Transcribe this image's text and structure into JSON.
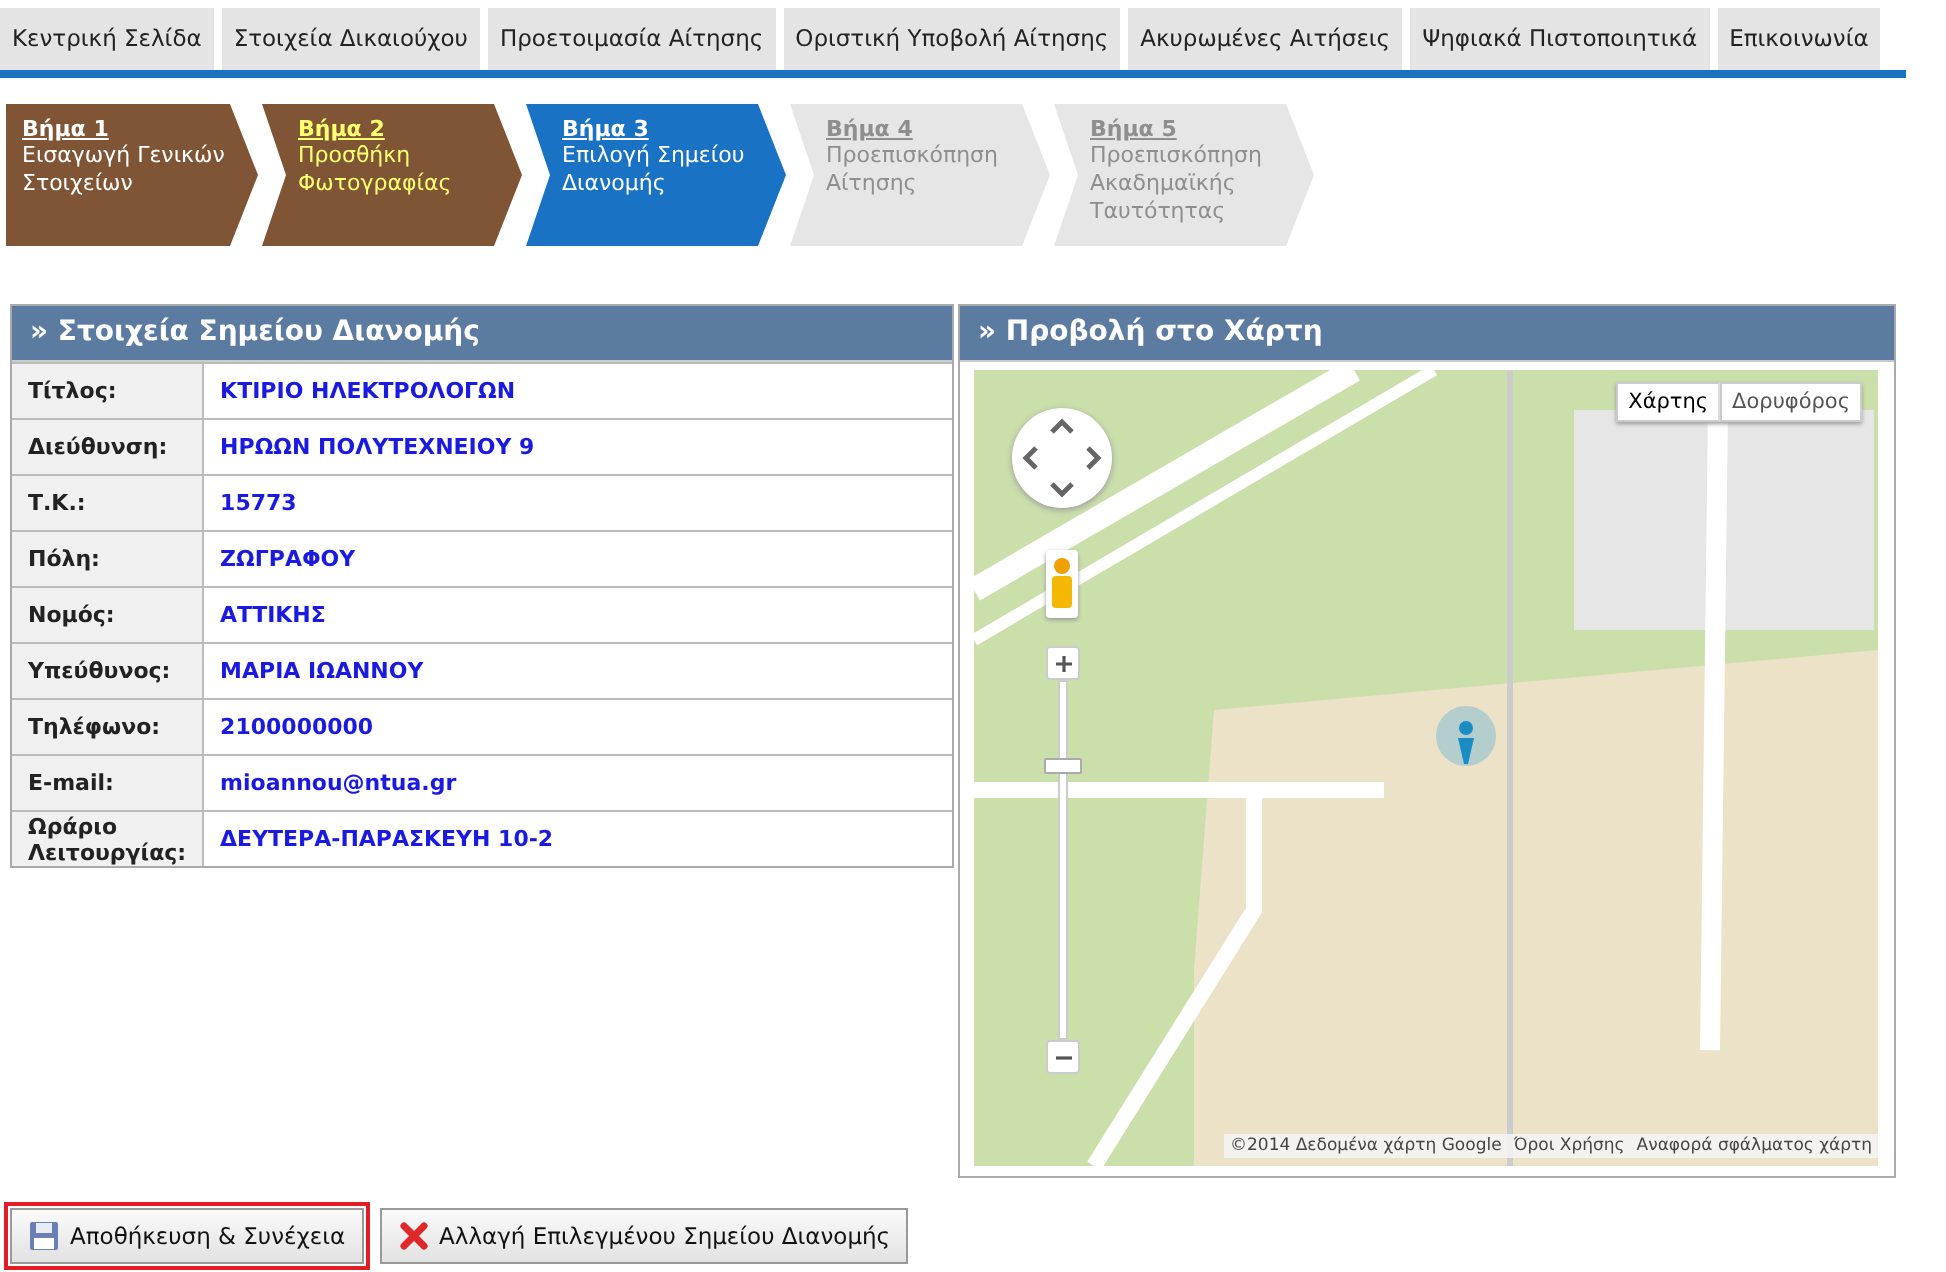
{
  "nav_tabs": [
    {
      "label": "Κεντρική Σελίδα",
      "selected": false
    },
    {
      "label": "Στοιχεία Δικαιούχου",
      "selected": false
    },
    {
      "label": "Προετοιμασία Αίτησης",
      "selected": false
    },
    {
      "label": "Οριστική Υποβολή Αίτησης",
      "selected": false
    },
    {
      "label": "Ακυρωμένες Αιτήσεις",
      "selected": false
    },
    {
      "label": "Ψηφιακά Πιστοποιητικά",
      "selected": false
    },
    {
      "label": "Επικοινωνία",
      "selected": false
    }
  ],
  "steps": [
    {
      "title": "Βήμα 1",
      "subtitle": "Εισαγωγή Γενικών Στοιχείων",
      "selected": false,
      "disabled": false,
      "highlighted": false
    },
    {
      "title": "Βήμα 2",
      "subtitle": "Προσθήκη Φωτογραφίας",
      "selected": false,
      "disabled": false,
      "highlighted": true
    },
    {
      "title": "Βήμα 3",
      "subtitle": "Επιλογή Σημείου Διανομής",
      "selected": true,
      "disabled": false,
      "highlighted": false
    },
    {
      "title": "Βήμα 4",
      "subtitle": "Προεπισκόπηση Αίτησης",
      "selected": false,
      "disabled": true,
      "highlighted": false
    },
    {
      "title": "Βήμα 5",
      "subtitle": "Προεπισκόπηση Ακαδημαϊκής Ταυτότητας",
      "selected": false,
      "disabled": true,
      "highlighted": false
    }
  ],
  "details_panel": {
    "title": "» Στοιχεία Σημείου Διανομής",
    "rows": [
      {
        "label": "Τίτλος:",
        "value": "ΚΤΙΡΙΟ ΗΛΕΚΤΡΟΛΟΓΩΝ"
      },
      {
        "label": "Διεύθυνση:",
        "value": "ΗΡΩΩΝ ΠΟΛΥΤΕΧΝΕΙΟΥ 9"
      },
      {
        "label": "Τ.Κ.:",
        "value": "15773"
      },
      {
        "label": "Πόλη:",
        "value": "ΖΩΓΡΑΦΟΥ"
      },
      {
        "label": "Νομός:",
        "value": "ΑΤΤΙΚΗΣ"
      },
      {
        "label": "Υπεύθυνος:",
        "value": "ΜΑΡΙΑ ΙΩΑΝΝΟΥ"
      },
      {
        "label": "Τηλέφωνο:",
        "value": "2100000000"
      },
      {
        "label": "E-mail:",
        "value": "mioannou@ntua.gr"
      },
      {
        "label": "Ωράριο Λειτουργίας:",
        "value": "ΔΕΥΤΕΡΑ-ΠΑΡΑΣΚΕΥΗ 10-2"
      }
    ]
  },
  "map_panel": {
    "title": "» Προβολή στο Χάρτη",
    "map_types": [
      {
        "label": "Χάρτης",
        "selected": true
      },
      {
        "label": "Δορυφόρος",
        "selected": false
      }
    ],
    "attribution": "©2014 Δεδομένα χάρτη Google",
    "terms_link": "Όροι Χρήσης",
    "report_link": "Αναφορά σφάλματος χάρτη"
  },
  "buttons": [
    {
      "label": "Αποθήκευση & Συνέχεια",
      "kind": "save",
      "focused": true
    },
    {
      "label": "Αλλαγή Επιλεγμένου Σημείου Διανομής",
      "kind": "cancel",
      "focused": false
    }
  ]
}
